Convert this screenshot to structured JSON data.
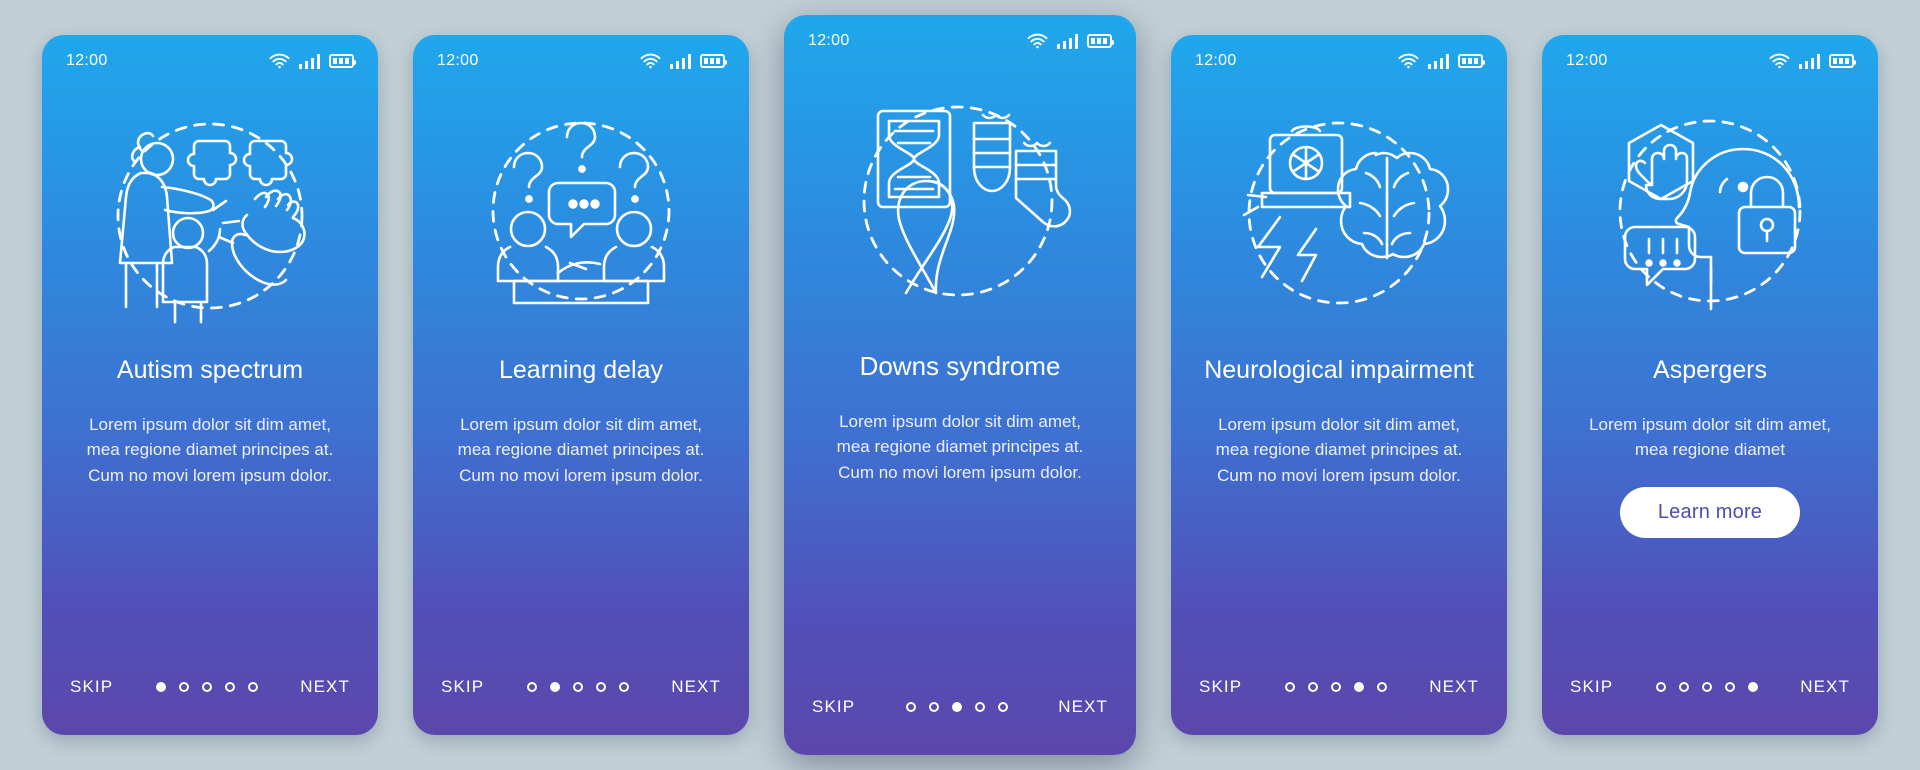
{
  "theme": {
    "page_background": "#c2d0d6",
    "gradient_top": "#1fa7ec",
    "gradient_bottom": "#5b47ab",
    "text_color": "#ffffff",
    "button_background": "#ffffff",
    "button_text_color": "#514bb0"
  },
  "status_bar": {
    "time": "12:00",
    "icons": [
      "wifi-icon",
      "cellular-signal-icon",
      "battery-icon"
    ]
  },
  "common": {
    "skip_label": "SKIP",
    "next_label": "NEXT",
    "total_dots": 5
  },
  "screens": [
    {
      "id": "autism-spectrum",
      "featured": false,
      "illustration": "mother-child-puzzle-clapping-hands-icon",
      "title": "Autism spectrum",
      "description": "Lorem ipsum dolor sit dim amet, mea regione diamet principes at. Cum no movi lorem ipsum dolor.",
      "active_dot": 1,
      "skip_label": "SKIP",
      "next_label": "NEXT",
      "has_button": false,
      "button_label": ""
    },
    {
      "id": "learning-delay",
      "featured": false,
      "illustration": "question-marks-people-speech-bubble-icon",
      "title": "Learning delay",
      "description": "Lorem ipsum dolor sit dim amet, mea regione diamet principes at. Cum no movi lorem ipsum dolor.",
      "active_dot": 2,
      "skip_label": "SKIP",
      "next_label": "NEXT",
      "has_button": false,
      "button_label": ""
    },
    {
      "id": "downs-syndrome",
      "featured": true,
      "illustration": "dna-hourglass-socks-ribbon-icon",
      "title": "Downs syndrome",
      "description": "Lorem ipsum dolor sit dim amet, mea regione diamet principes at. Cum no movi lorem ipsum dolor.",
      "active_dot": 3,
      "skip_label": "SKIP",
      "next_label": "NEXT",
      "has_button": false,
      "button_label": ""
    },
    {
      "id": "neurological-impairment",
      "featured": false,
      "illustration": "brain-lightning-lamp-icon",
      "title": "Neurological impairment",
      "description": "Lorem ipsum dolor sit dim amet, mea regione diamet principes at. Cum no movi lorem ipsum dolor.",
      "active_dot": 4,
      "skip_label": "SKIP",
      "next_label": "NEXT",
      "has_button": false,
      "button_label": ""
    },
    {
      "id": "aspergers",
      "featured": false,
      "illustration": "stop-hand-head-lock-speech-bubble-icon",
      "title": "Aspergers",
      "description": "Lorem ipsum dolor sit dim amet, mea regione diamet",
      "active_dot": 5,
      "skip_label": "SKIP",
      "next_label": "NEXT",
      "has_button": true,
      "button_label": "Learn more"
    }
  ]
}
